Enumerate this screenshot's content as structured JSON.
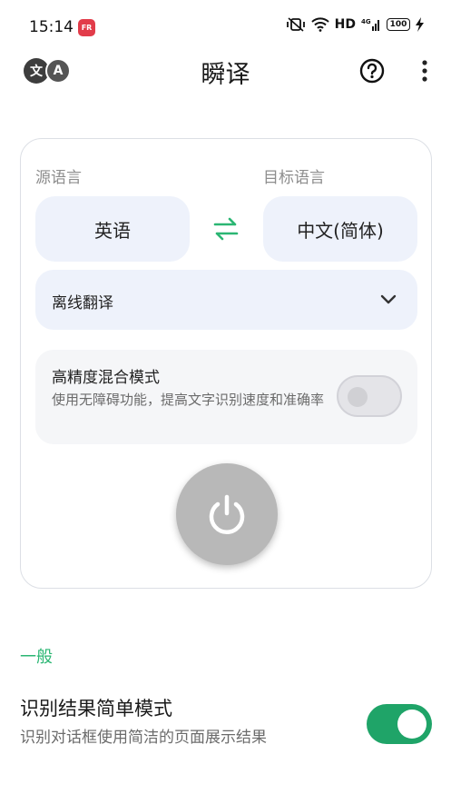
{
  "status_bar": {
    "time": "15:14",
    "badge_icon": "app-notification-icon",
    "badge_text": "FR",
    "network": "HD",
    "battery": "100"
  },
  "app_bar": {
    "logo_left": "文",
    "logo_right": "A",
    "title": "瞬译",
    "help_icon": "help-circle-icon",
    "more_icon": "more-vertical-icon"
  },
  "translate_card": {
    "source_label": "源语言",
    "target_label": "目标语言",
    "source_lang": "英语",
    "target_lang": "中文(简体)",
    "swap_icon": "swap-arrows-icon",
    "mode": "离线翻译",
    "high_precision": {
      "title": "高精度混合模式",
      "desc": "使用无障碍功能，提高文字识别速度和准确率",
      "enabled": false
    },
    "power_icon": "power-icon"
  },
  "general": {
    "section_title": "一般",
    "simple_mode_title": "识别结果简单模式",
    "simple_mode_desc": "识别对话框使用简洁的页面展示结果",
    "simple_mode_enabled": true
  },
  "colors": {
    "accent": "#1fa468",
    "section_title": "#2bb673",
    "tile_bg": "#eef2fb"
  }
}
